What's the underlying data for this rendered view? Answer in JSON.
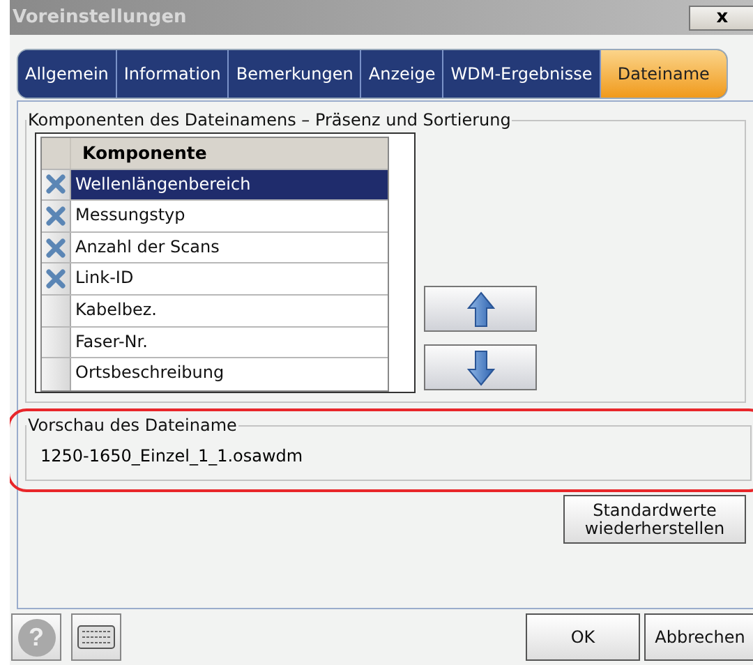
{
  "window": {
    "title": "Voreinstellungen",
    "close": "x"
  },
  "tabs": [
    {
      "label": "Allgemein",
      "selected": false
    },
    {
      "label": "Information",
      "selected": false
    },
    {
      "label": "Bemerkungen",
      "selected": false
    },
    {
      "label": "Anzeige",
      "selected": false
    },
    {
      "label": "WDM-Ergebnisse",
      "selected": false
    },
    {
      "label": "Dateiname",
      "selected": true
    }
  ],
  "components": {
    "title": "Komponenten des Dateinamens – Präsenz und Sortierung",
    "column": "Komponente",
    "rows": [
      {
        "label": "Wellenlängenbereich",
        "checked": true,
        "selected": true
      },
      {
        "label": "Messungstyp",
        "checked": true,
        "selected": false
      },
      {
        "label": "Anzahl der Scans",
        "checked": true,
        "selected": false
      },
      {
        "label": "Link-ID",
        "checked": true,
        "selected": false
      },
      {
        "label": "Kabelbez.",
        "checked": false,
        "selected": false
      },
      {
        "label": "Faser-Nr.",
        "checked": false,
        "selected": false
      },
      {
        "label": "Ortsbeschreibung",
        "checked": false,
        "selected": false
      }
    ]
  },
  "preview": {
    "title": "Vorschau des Dateiname",
    "value": "1250-1650_Einzel_1_1.osawdm"
  },
  "restore_button": "Standardwerte wiederherstellen",
  "help_button": "?",
  "buttons": [
    "OK",
    "Abbrechen"
  ]
}
